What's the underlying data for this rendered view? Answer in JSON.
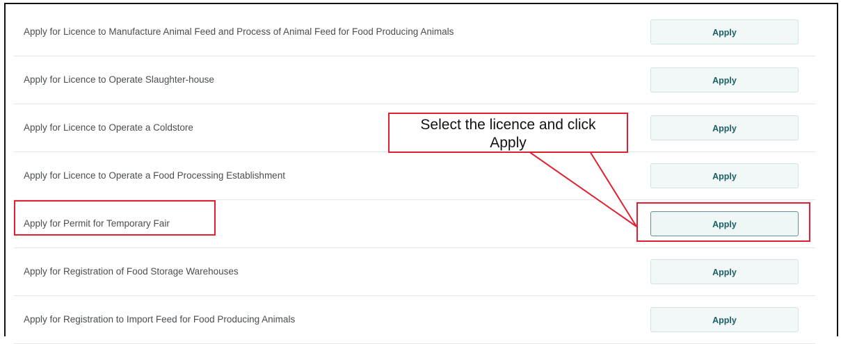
{
  "licences": [
    {
      "label": "Apply for Licence to Manufacture Animal Feed and Process of Animal Feed for Food Producing Animals",
      "button": "Apply"
    },
    {
      "label": "Apply for Licence to Operate Slaughter-house",
      "button": "Apply"
    },
    {
      "label": "Apply for Licence to Operate a Coldstore",
      "button": "Apply"
    },
    {
      "label": "Apply for Licence to Operate a Food Processing Establishment",
      "button": "Apply"
    },
    {
      "label": "Apply for Permit for Temporary Fair",
      "button": "Apply"
    },
    {
      "label": "Apply for Registration of Food Storage Warehouses",
      "button": "Apply"
    },
    {
      "label": "Apply for Registration to Import Feed for Food Producing Animals",
      "button": "Apply"
    }
  ],
  "callout": {
    "line1": "Select the licence and click",
    "line2": "Apply"
  },
  "colors": {
    "highlight": "#e02030",
    "button_text": "#1d5f66",
    "button_bg": "#f1f8f7"
  }
}
